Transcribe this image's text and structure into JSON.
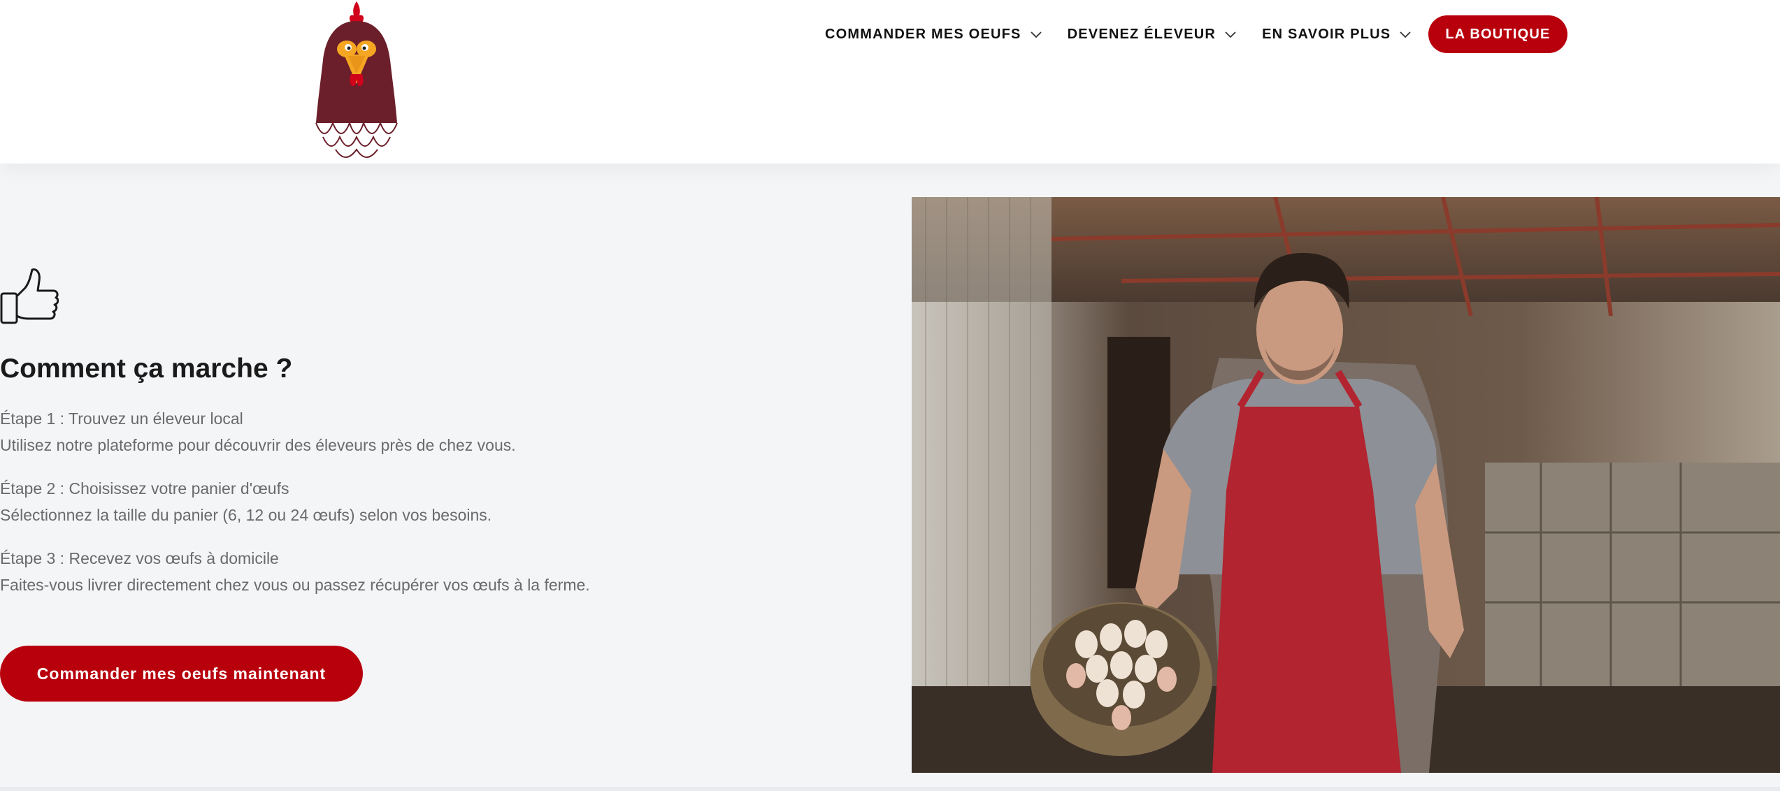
{
  "header": {
    "logo": {
      "name": "rooster-logo"
    },
    "nav": [
      {
        "label": "COMMANDER MES OEUFS",
        "has_dropdown": true
      },
      {
        "label": "DEVENEZ ÉLEVEUR",
        "has_dropdown": true
      },
      {
        "label": "EN SAVOIR PLUS",
        "has_dropdown": true
      }
    ],
    "shop_button": "LA BOUTIQUE"
  },
  "main": {
    "icon": "thumbs-up-icon",
    "title": "Comment ça marche ?",
    "steps": [
      {
        "heading": "Étape 1 : Trouvez un éleveur local",
        "text": "Utilisez notre plateforme pour découvrir des éleveurs près de chez vous."
      },
      {
        "heading": "Étape 2 : Choisissez votre panier d'œufs",
        "text": "Sélectionnez la taille du panier (6, 12 ou 24 œufs) selon vos besoins."
      },
      {
        "heading": "Étape 3 : Recevez vos œufs à domicile",
        "text": "Faites-vous livrer directement chez vous ou passez récupérer vos œufs à la ferme."
      }
    ],
    "cta": "Commander mes oeufs maintenant",
    "photo": "farmer-holding-egg-basket"
  },
  "colors": {
    "accent": "#b8000d",
    "section_bg": "#f4f5f7",
    "text_muted": "#6a6a6a",
    "logo_body": "#6b1f2a",
    "logo_beak": "#f5a623"
  }
}
